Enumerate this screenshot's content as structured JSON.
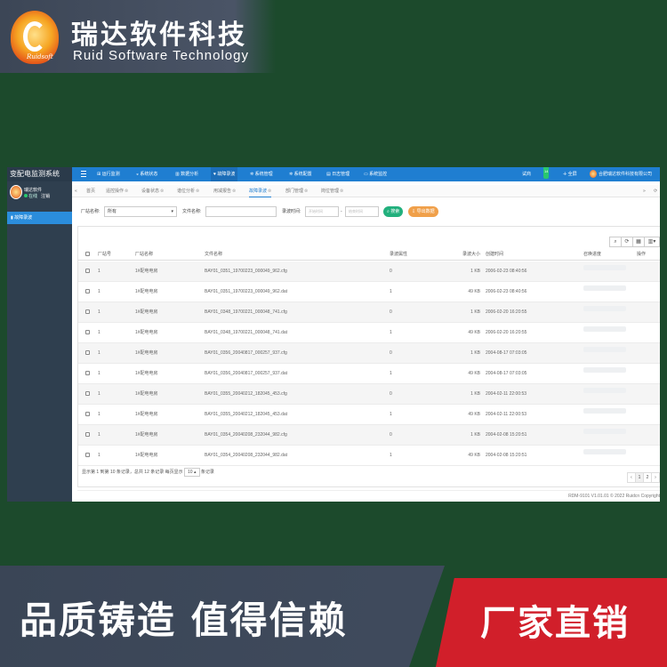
{
  "brand": {
    "cn": "瑞达软件科技",
    "en": "Ruid Software Technology",
    "logo_tag": "Ruidsoft"
  },
  "sidebar": {
    "system_title": "变配电监测系统",
    "user_name": "瑞达软件",
    "status_online": "在线",
    "logout": "注销",
    "items": [
      {
        "label": "故障录波"
      }
    ]
  },
  "topnav": {
    "items": [
      "运行监测",
      "系统状态",
      "数据分析",
      "故障录波",
      "系统管理",
      "系统配置",
      "日志管理",
      "系统监控"
    ],
    "active": "故障录波",
    "right_user": "试商",
    "badge": "14",
    "fullscreen": "全屏",
    "company": "合肥瑞达软件科技有限公司"
  },
  "tabs": [
    "首页",
    "遥控操作",
    "设备状态",
    "谐位分析",
    "用减报告",
    "故障录波",
    "部门管理",
    "岗位管理"
  ],
  "active_tab": "故障录波",
  "filters": {
    "station_label": "厂站名称:",
    "station_value": "所有",
    "file_label": "文件名称:",
    "file_value": "",
    "time_label": "录波时间:",
    "start_placeholder": "开始时间",
    "end_placeholder": "结束时间",
    "range_sep": "-",
    "search_btn": "搜索",
    "export_btn": "导出数据"
  },
  "table": {
    "columns": [
      "厂站号",
      "厂站名称",
      "文件名称",
      "录波属性",
      "录波大小",
      "创建时间",
      "召唤进度",
      "操作"
    ],
    "rows": [
      {
        "no": "1",
        "station": "1#配电电房",
        "file": "BAY01_0351_19700223_000049_962.cfg",
        "attr": "0",
        "size": "1 KB",
        "time": "2006-02-23 08:40:56"
      },
      {
        "no": "1",
        "station": "1#配电电房",
        "file": "BAY01_0351_19700223_000049_962.dat",
        "attr": "1",
        "size": "49 KB",
        "time": "2006-02-23 08:40:56"
      },
      {
        "no": "1",
        "station": "1#配电电房",
        "file": "BAY01_0348_19700221_000048_741.cfg",
        "attr": "0",
        "size": "1 KB",
        "time": "2006-02-20 16:20:55"
      },
      {
        "no": "1",
        "station": "1#配电电房",
        "file": "BAY01_0348_19700221_000048_741.dat",
        "attr": "1",
        "size": "49 KB",
        "time": "2006-02-20 16:20:55"
      },
      {
        "no": "1",
        "station": "1#配电电房",
        "file": "BAY01_0356_20040817_000257_937.cfg",
        "attr": "0",
        "size": "1 KB",
        "time": "2004-08-17 07:03:05"
      },
      {
        "no": "1",
        "station": "1#配电电房",
        "file": "BAY01_0356_20040817_000257_937.dat",
        "attr": "1",
        "size": "49 KB",
        "time": "2004-08-17 07:03:05"
      },
      {
        "no": "1",
        "station": "1#配电电房",
        "file": "BAY01_0355_20040212_182045_453.cfg",
        "attr": "0",
        "size": "1 KB",
        "time": "2004-02-11 22:00:53"
      },
      {
        "no": "1",
        "station": "1#配电电房",
        "file": "BAY01_0355_20040212_182045_453.dat",
        "attr": "1",
        "size": "49 KB",
        "time": "2004-02-11 22:00:53"
      },
      {
        "no": "1",
        "station": "1#配电电房",
        "file": "BAY01_0354_20040208_232044_982.cfg",
        "attr": "0",
        "size": "1 KB",
        "time": "2004-02-08 15:20:51"
      },
      {
        "no": "1",
        "station": "1#配电电房",
        "file": "BAY01_0354_20040208_232044_982.dat",
        "attr": "1",
        "size": "49 KB",
        "time": "2004-02-08 15:20:51"
      }
    ]
  },
  "pagination": {
    "info_prefix": "显示第 1 到第 10 条记录，总共 12 条记录  每页显示",
    "page_size": "10",
    "info_suffix": "条记录",
    "prev": "‹",
    "pages": [
      "1",
      "2"
    ],
    "next": "›"
  },
  "footer": "RDM-9101 V1.01.01 © 2022 Ruidcn Copyright",
  "banner": {
    "left": "品质铸造 值得信赖",
    "right": "厂家直销"
  },
  "colors": {
    "nav_blue": "#1f7ed1",
    "sidebar": "#2f3f4f",
    "banner_red": "#d11f2a",
    "bg_green": "#1c4a2c"
  }
}
